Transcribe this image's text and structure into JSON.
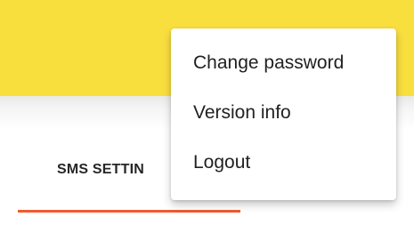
{
  "tabs": {
    "active_label": "SMS SETTIN"
  },
  "menu": {
    "items": [
      {
        "label": "Change password"
      },
      {
        "label": "Version info"
      },
      {
        "label": "Logout"
      }
    ]
  },
  "colors": {
    "app_bar": "#f9df3e",
    "tab_indicator": "#f05a2c",
    "menu_background": "#ffffff",
    "text": "#212121"
  }
}
